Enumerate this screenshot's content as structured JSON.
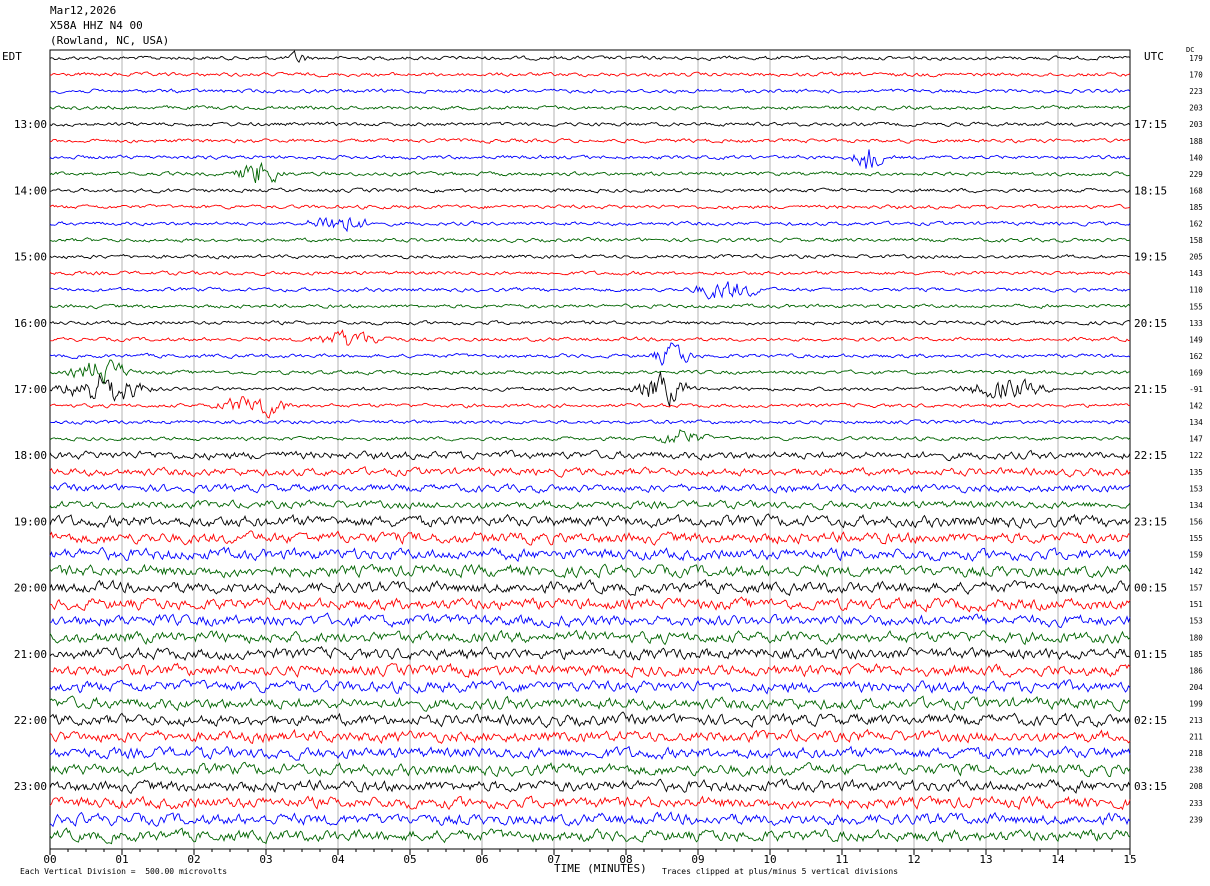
{
  "header": {
    "date": "Mar12,2026",
    "station": "X58A HHZ N4 00",
    "location": "(Rowland, NC, USA)"
  },
  "left_tz": "EDT",
  "right_tz": "UTC",
  "dc_label": "DC",
  "footer": {
    "scale": "Each Vertical Division =  500.00 microvolts",
    "clip": "Traces clipped at plus/minus 5 vertical divisions"
  },
  "colors": {
    "trace_cycle": [
      "#000000",
      "#ff0000",
      "#0000ff",
      "#006400"
    ],
    "grid": "#808080"
  },
  "chart_data": {
    "type": "line",
    "title": "",
    "xlabel": "TIME (MINUTES)",
    "ylabel": "",
    "xlim": [
      0,
      15
    ],
    "x_ticks": [
      "00",
      "01",
      "02",
      "03",
      "04",
      "05",
      "06",
      "07",
      "08",
      "09",
      "10",
      "11",
      "12",
      "13",
      "14",
      "15"
    ],
    "left_time_labels": [
      "13:00",
      "14:00",
      "15:00",
      "16:00",
      "17:00",
      "18:00",
      "19:00",
      "20:00",
      "21:00",
      "22:00",
      "23:00"
    ],
    "right_time_labels": [
      "17:15",
      "18:15",
      "19:15",
      "20:15",
      "21:15",
      "22:15",
      "23:15",
      "00:15",
      "01:15",
      "02:15",
      "03:15"
    ],
    "minutes_per_trace": 15,
    "trace_count": 48,
    "dc_offsets": [
      "179",
      "170",
      "223",
      "203",
      "203",
      "188",
      "140",
      "229",
      "168",
      "185",
      "162",
      "158",
      "205",
      "143",
      "110",
      "155",
      "133",
      "149",
      "162",
      "169",
      "-91",
      "142",
      "134",
      "147",
      "122",
      "135",
      "153",
      "134",
      "156",
      "155",
      "159",
      "142",
      "157",
      "151",
      "153",
      "180",
      "185",
      "186",
      "204",
      "199",
      "213",
      "211",
      "218",
      "238",
      "208",
      "233",
      "239"
    ]
  }
}
